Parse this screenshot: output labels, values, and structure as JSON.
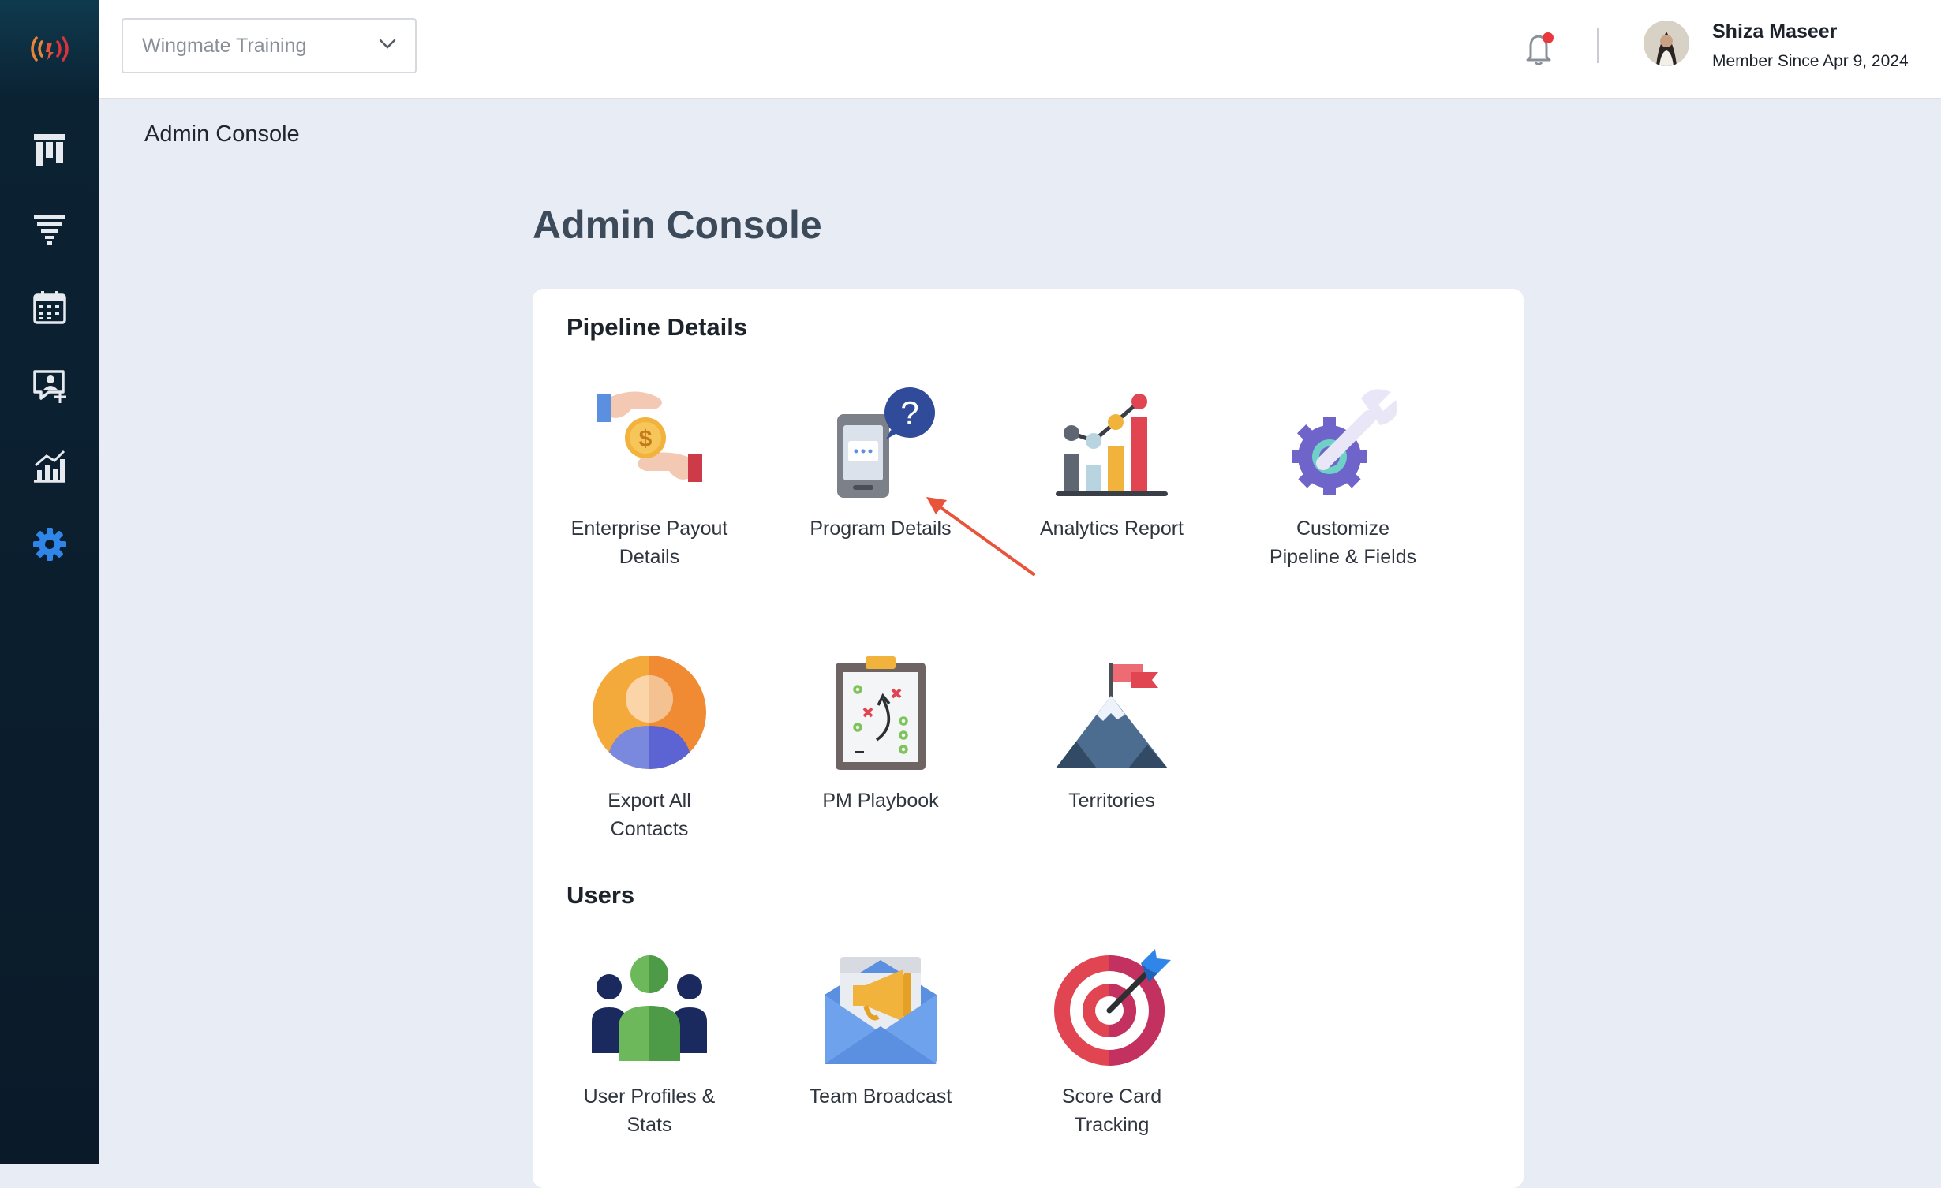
{
  "sidebar": {
    "logo_icon": "broadcast-waves-icon",
    "items": [
      {
        "icon": "kanban-board-icon"
      },
      {
        "icon": "funnel-filter-icon"
      },
      {
        "icon": "calendar-icon"
      },
      {
        "icon": "chat-user-icon"
      },
      {
        "icon": "analytics-chart-icon"
      },
      {
        "icon": "gear-icon",
        "active": true
      }
    ],
    "active_color": "#2f86e8"
  },
  "topbar": {
    "workspace_select": {
      "value": "Wingmate Training",
      "icon": "chevron-down-icon"
    },
    "notification": {
      "icon": "bell-icon",
      "has_unread": true,
      "dot_color": "#e8383d"
    },
    "user": {
      "name": "Shiza Maseer",
      "member_since": "Member Since Apr 9, 2024"
    }
  },
  "breadcrumb": "Admin Console",
  "page_title": "Admin Console",
  "sections": {
    "pipeline": {
      "title": "Pipeline Details",
      "items": [
        {
          "label_lines": [
            "Enterprise Payout",
            "Details"
          ],
          "icon": "payout-hands-icon"
        },
        {
          "label_lines": [
            "Program Details"
          ],
          "icon": "phone-question-icon"
        },
        {
          "label_lines": [
            "Analytics Report"
          ],
          "icon": "bar-chart-icon"
        },
        {
          "label_lines": [
            "Customize",
            "Pipeline & Fields"
          ],
          "icon": "gear-wrench-icon"
        },
        {
          "label_lines": [
            "Export All",
            "Contacts"
          ],
          "icon": "contact-avatar-icon"
        },
        {
          "label_lines": [
            "PM Playbook"
          ],
          "icon": "clipboard-playbook-icon"
        },
        {
          "label_lines": [
            "Territories"
          ],
          "icon": "mountain-flag-icon"
        }
      ]
    },
    "users": {
      "title": "Users",
      "items": [
        {
          "label_lines": [
            "User Profiles &",
            "Stats"
          ],
          "icon": "user-group-icon"
        },
        {
          "label_lines": [
            "Team Broadcast"
          ],
          "icon": "megaphone-envelope-icon"
        },
        {
          "label_lines": [
            "Score Card",
            "Tracking"
          ],
          "icon": "target-dart-icon"
        }
      ]
    }
  },
  "annotation": {
    "type": "arrow",
    "color": "#e8543a",
    "points_to": "Program Details"
  }
}
